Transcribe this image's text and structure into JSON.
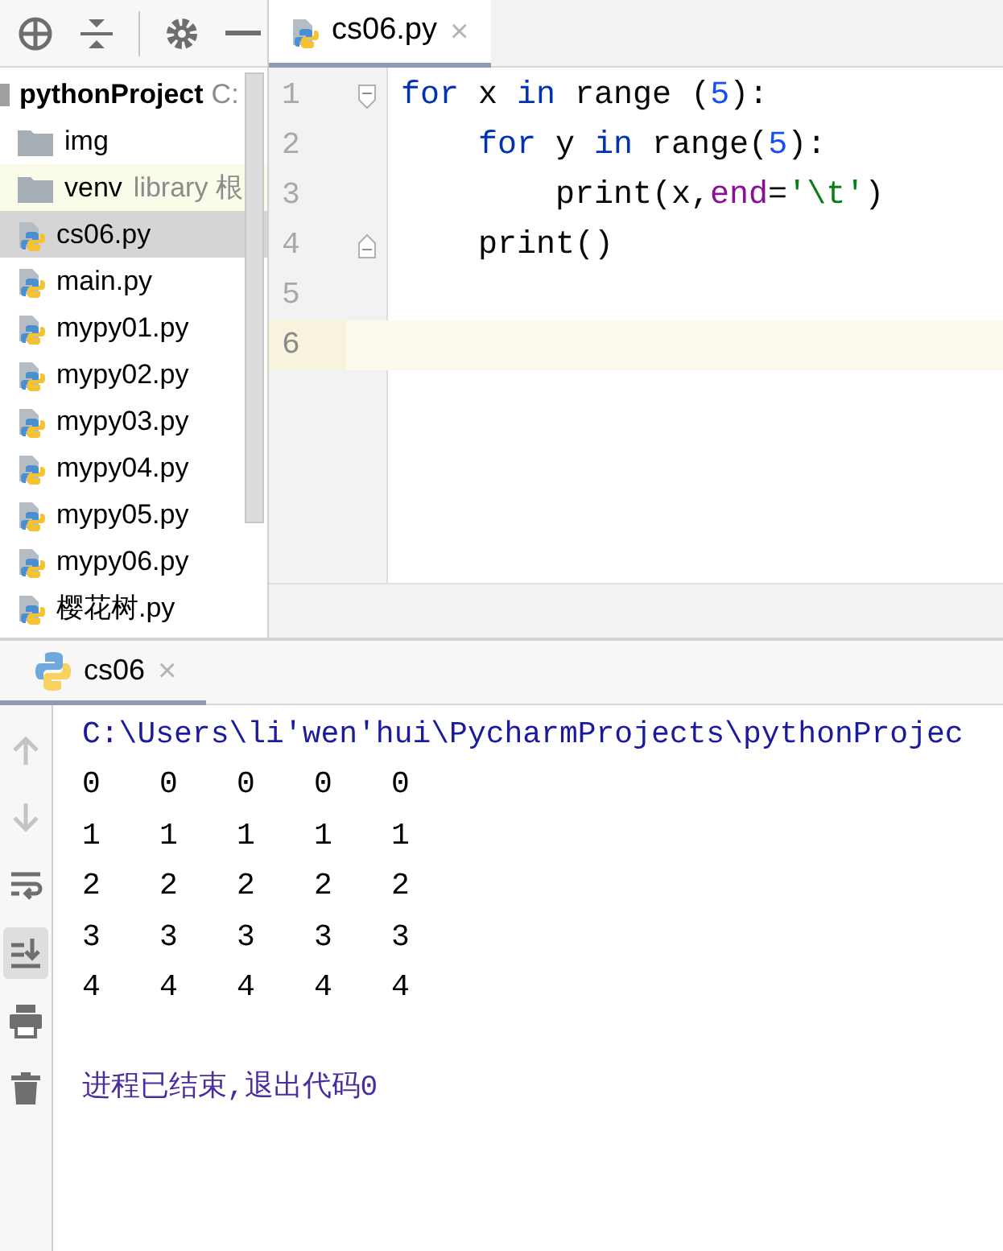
{
  "project_toolbar": {
    "buttons": [
      {
        "kind": "locate"
      },
      {
        "kind": "collapse"
      },
      {
        "kind": "settings"
      },
      {
        "kind": "hide"
      }
    ]
  },
  "project_tree": {
    "label": "pythonProject",
    "hint": "C:",
    "expanded": true,
    "children": [
      {
        "label": "img",
        "kind": "folder",
        "selected": false
      },
      {
        "label": "venv",
        "kind": "folder",
        "hint": "library 根",
        "selected": false
      },
      {
        "label": "cs06.py",
        "kind": "python",
        "selected": true
      },
      {
        "label": "main.py",
        "kind": "python",
        "selected": false
      },
      {
        "label": "mypy01.py",
        "kind": "python",
        "selected": false
      },
      {
        "label": "mypy02.py",
        "kind": "python",
        "selected": false
      },
      {
        "label": "mypy03.py",
        "kind": "python",
        "selected": false
      },
      {
        "label": "mypy04.py",
        "kind": "python",
        "selected": false
      },
      {
        "label": "mypy05.py",
        "kind": "python",
        "selected": false
      },
      {
        "label": "mypy06.py",
        "kind": "python",
        "selected": false
      },
      {
        "label": "樱花树.py",
        "kind": "python",
        "selected": false
      }
    ]
  },
  "editor_tabs": [
    {
      "label": "cs06.py",
      "close": "×",
      "selected": true
    }
  ],
  "editor_lines": [
    {
      "number": "1",
      "kind": "fold-start",
      "current": false,
      "tokens": [
        {
          "kind": "keyword",
          "text": "for"
        },
        {
          "kind": "plain",
          "text": " x "
        },
        {
          "kind": "keyword",
          "text": "in"
        },
        {
          "kind": "plain",
          "text": " range "
        },
        {
          "kind": "plain",
          "text": "("
        },
        {
          "kind": "number",
          "text": "5"
        },
        {
          "kind": "plain",
          "text": "):"
        }
      ]
    },
    {
      "number": "2",
      "current": false,
      "tokens": [
        {
          "kind": "keyword",
          "text": "    for"
        },
        {
          "kind": "plain",
          "text": " y "
        },
        {
          "kind": "keyword",
          "text": "in"
        },
        {
          "kind": "plain",
          "text": " range("
        },
        {
          "kind": "number",
          "text": "5"
        },
        {
          "kind": "plain",
          "text": "):"
        }
      ]
    },
    {
      "number": "3",
      "current": false,
      "tokens": [
        {
          "kind": "plain",
          "text": "        print(x,"
        },
        {
          "kind": "param",
          "text": "end"
        },
        {
          "kind": "plain",
          "text": "="
        },
        {
          "kind": "string",
          "text": "'\\t'"
        },
        {
          "kind": "plain",
          "text": ")"
        }
      ]
    },
    {
      "number": "4",
      "kind": "fold-end",
      "current": false,
      "tokens": [
        {
          "kind": "plain",
          "text": "    print()"
        }
      ]
    },
    {
      "number": "5",
      "current": false
    },
    {
      "number": "6",
      "current": true
    }
  ],
  "run_tabs": [
    {
      "label": "cs06",
      "close": "×",
      "selected": true
    }
  ],
  "run_toolbar": [
    {
      "kind": "up",
      "disabled": true,
      "on": false
    },
    {
      "kind": "down",
      "disabled": true,
      "on": false
    },
    {
      "kind": "wrap",
      "disabled": false,
      "on": false
    },
    {
      "kind": "scroll-end",
      "disabled": false,
      "on": true
    },
    {
      "kind": "print",
      "disabled": false,
      "on": false
    },
    {
      "kind": "trash",
      "disabled": false,
      "on": false
    }
  ],
  "console": [
    {
      "kind": "command",
      "text": "C:\\Users\\li'wen'hui\\PycharmProjects\\pythonProjec"
    },
    {
      "kind": "output",
      "cells": [
        "0",
        "0",
        "0",
        "0",
        "0"
      ]
    },
    {
      "kind": "output",
      "cells": [
        "1",
        "1",
        "1",
        "1",
        "1"
      ]
    },
    {
      "kind": "output",
      "cells": [
        "2",
        "2",
        "2",
        "2",
        "2"
      ]
    },
    {
      "kind": "output",
      "cells": [
        "3",
        "3",
        "3",
        "3",
        "3"
      ]
    },
    {
      "kind": "output",
      "cells": [
        "4",
        "4",
        "4",
        "4",
        "4"
      ]
    },
    {
      "kind": "blank"
    },
    {
      "kind": "exit",
      "text": "进程已结束,退出代码0"
    }
  ]
}
